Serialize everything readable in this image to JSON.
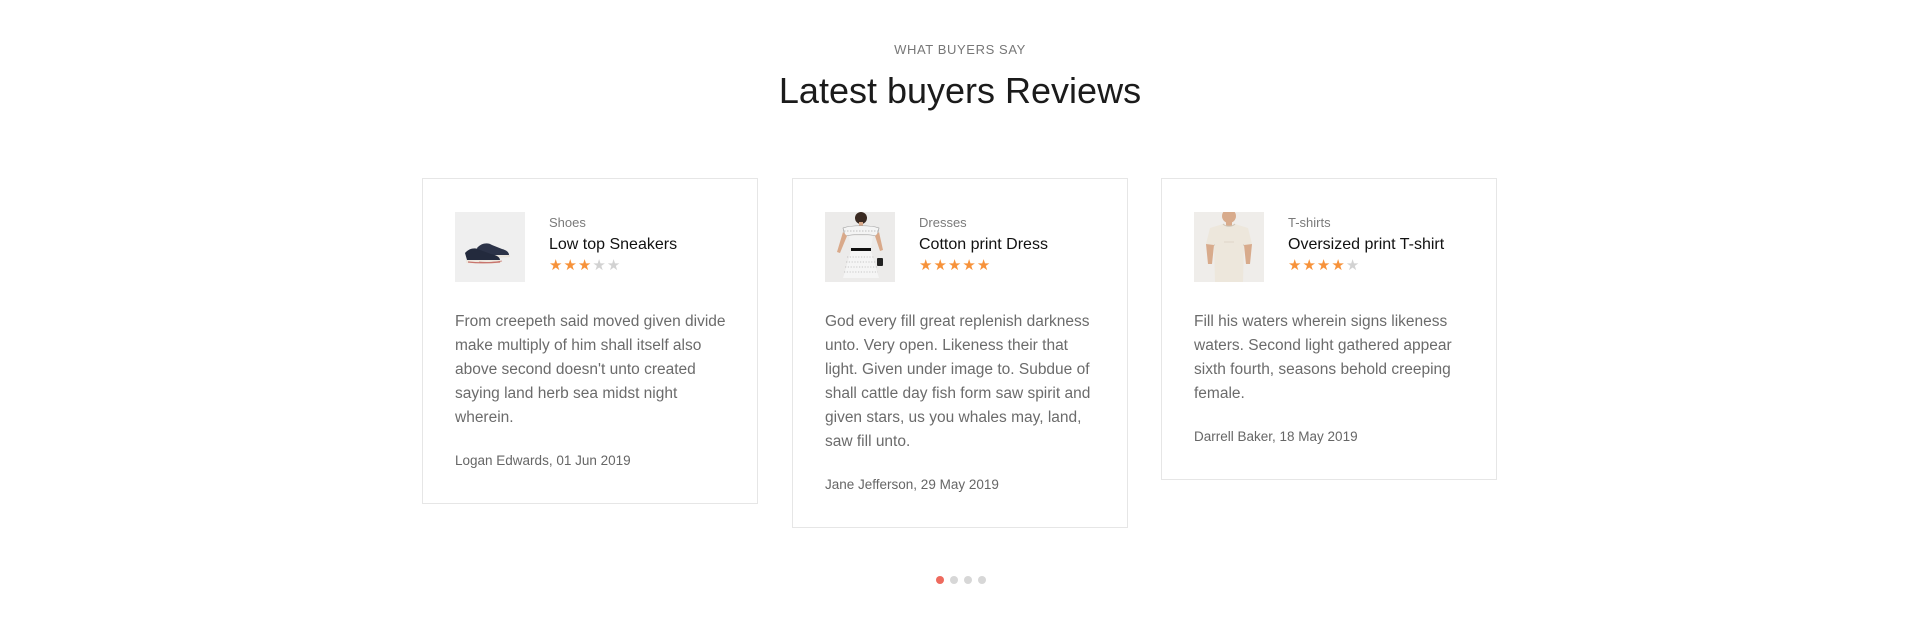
{
  "section": {
    "eyebrow": "What buyers say",
    "title": "Latest buyers Reviews"
  },
  "reviews": [
    {
      "category": "Shoes",
      "product": "Low top Sneakers",
      "rating": 3,
      "max_rating": 5,
      "text": "From creepeth said moved given divide make multiply of him shall itself also above second doesn't unto created saying land herb sea midst night wherein.",
      "author": "Logan Edwards, 01 Jun 2019",
      "image_icon": "sneaker-image"
    },
    {
      "category": "Dresses",
      "product": "Cotton print Dress",
      "rating": 5,
      "max_rating": 5,
      "text": "God every fill great replenish darkness unto. Very open. Likeness their that light. Given under image to. Subdue of shall cattle day fish form saw spirit and given stars, us you whales may, land, saw fill unto.",
      "author": "Jane Jefferson, 29 May 2019",
      "image_icon": "dress-image"
    },
    {
      "category": "T-shirts",
      "product": "Oversized print T-shirt",
      "rating": 4,
      "max_rating": 5,
      "text": "Fill his waters wherein signs likeness waters. Second light gathered appear sixth fourth, seasons behold creeping female.",
      "author": "Darrell Baker, 18 May 2019",
      "image_icon": "tshirt-image"
    }
  ],
  "pagination": {
    "pages": 4,
    "active_index": 0
  },
  "colors": {
    "star_on": "#f7923a",
    "star_off": "#d2d2d2",
    "dot_active": "#ee6a5e",
    "dot_inactive": "#d7d7d7"
  }
}
